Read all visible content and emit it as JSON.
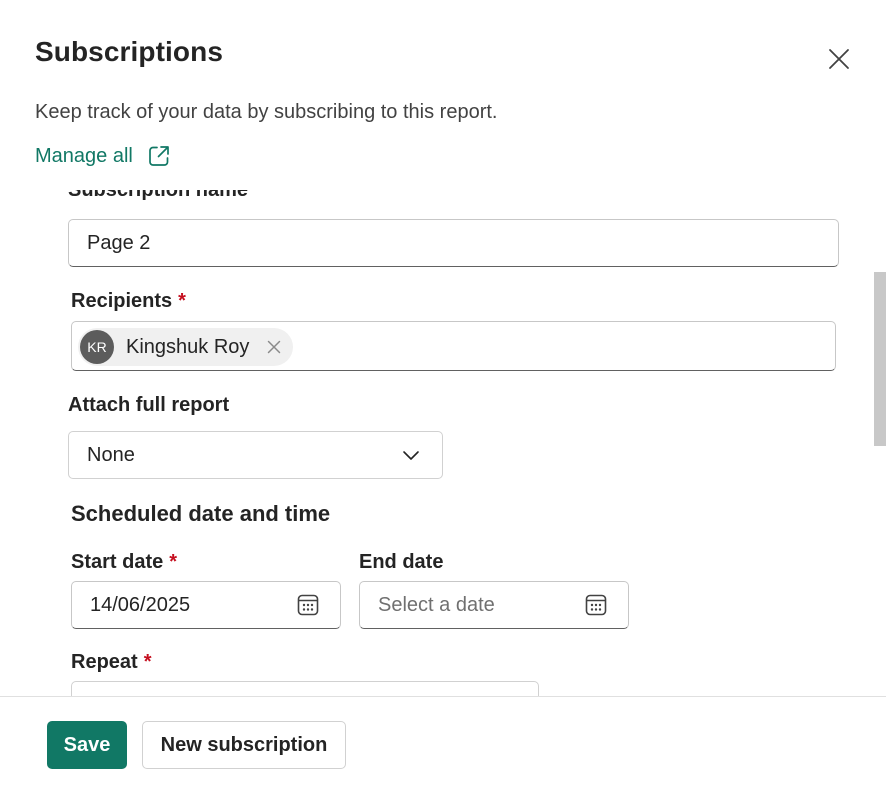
{
  "header": {
    "title": "Subscriptions",
    "description": "Keep track of your data by subscribing to this report.",
    "manage_link": "Manage all"
  },
  "form": {
    "subscription_name": {
      "label": "Subscription name",
      "value": "Page 2"
    },
    "recipients": {
      "label": "Recipients",
      "required_mark": "*",
      "chips": [
        {
          "initials": "KR",
          "name": "Kingshuk Roy"
        }
      ]
    },
    "attach_full_report": {
      "label": "Attach full report",
      "selected": "None"
    },
    "schedule": {
      "title": "Scheduled date and time",
      "start_date": {
        "label": "Start date",
        "required_mark": "*",
        "value": "14/06/2025"
      },
      "end_date": {
        "label": "End date",
        "placeholder": "Select a date"
      },
      "repeat": {
        "label": "Repeat",
        "required_mark": "*"
      }
    }
  },
  "footer": {
    "save_label": "Save",
    "new_subscription_label": "New subscription"
  },
  "icons": {
    "close": "close-icon",
    "external_link": "open-in-new-icon",
    "chevron": "chevron-down-icon",
    "calendar": "calendar-icon",
    "remove": "dismiss-icon"
  },
  "colors": {
    "accent": "#117865",
    "required": "#c50f1f",
    "avatar_bg": "#5c5c5c"
  }
}
